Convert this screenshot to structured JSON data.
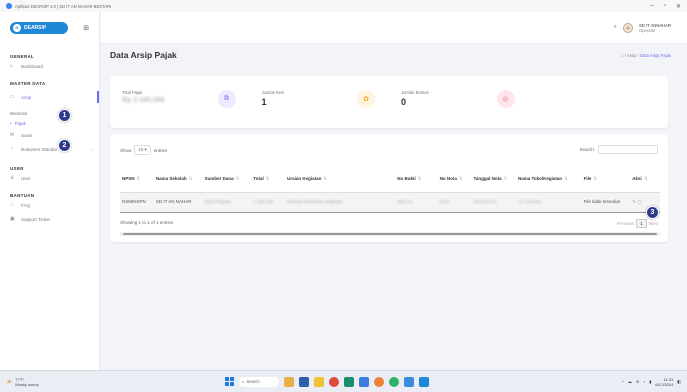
{
  "window": {
    "title": "Aplikasi DEARSIP 2.0 | SD IT AN NAHAR BESTARI"
  },
  "logo": {
    "text": "DEARSIP"
  },
  "sidebar": {
    "sections": {
      "general": "GENERAL",
      "master": "MASTER DATA",
      "user": "USER",
      "help": "BANTUAN"
    },
    "items": {
      "dashboard": "Dashboard",
      "arsip": "Arsip",
      "sub_heading": "Beranda",
      "pajak": "Pajak",
      "surat": "Surat",
      "dokumen": "Dokumen Standar",
      "users": "User",
      "faq": "FAQ",
      "support": "Support Ticket"
    }
  },
  "badges": {
    "b1": "1",
    "b2": "2",
    "b3": "3"
  },
  "topbar": {
    "user_name": "SD IT ANNAHAR",
    "user_role": "Operator"
  },
  "page": {
    "title": "Data Arsip Pajak"
  },
  "breadcrumb": {
    "home": "Arsip",
    "sep": "/",
    "current": "Data Arsip Pajak"
  },
  "stats": [
    {
      "label": "Total Pajak",
      "value": "Rp 2.195.000"
    },
    {
      "label": "Jumlah Item",
      "value": "1"
    },
    {
      "label": "Jumlah Berkas",
      "value": "0"
    },
    {
      "label": "",
      "value": ""
    }
  ],
  "table_controls": {
    "show": "Show",
    "entries_value": "10",
    "entries": "entries",
    "search": "Search:"
  },
  "table": {
    "headers": [
      "NPSN",
      "Nama Sekolah",
      "Sumber Dana",
      "Total",
      "Uraian Kegiatan",
      "No Bukti",
      "No Nota",
      "Tanggal Nota",
      "Nama Toko/Kegiatan",
      "File",
      "Aksi"
    ],
    "rows": [
      [
        "NSM/NSPN",
        "SD IT AN NAHAR",
        "BOS Reguler",
        "2.195.000",
        "Belanja kebutuhan kegiatan",
        "BKU-01",
        "N-01",
        "2023-01-01",
        "CV Sumber",
        "File tidak tersedia!",
        ""
      ]
    ]
  },
  "table_footer": {
    "info": "Showing 1 to 1 of 1 entries",
    "prev": "Previous",
    "page": "1",
    "next": "Next"
  },
  "taskbar": {
    "weather_temp": "77°F",
    "weather_desc": "Mostly sunny",
    "search": "Search",
    "time": "11:31",
    "date": "6/17/2024"
  }
}
